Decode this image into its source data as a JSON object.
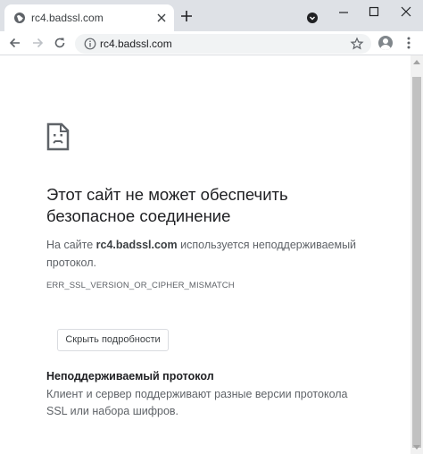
{
  "tab": {
    "title": "rc4.badssl.com"
  },
  "toolbar": {
    "url": "rc4.badssl.com"
  },
  "error": {
    "heading": "Этот сайт не может обеспечить безопасное соединение",
    "explain_prefix": "На сайте ",
    "explain_host": "rc4.badssl.com",
    "explain_suffix": " используется неподдерживаемый протокол.",
    "code": "ERR_SSL_VERSION_OR_CIPHER_MISMATCH",
    "details_button": "Скрыть подробности",
    "details_title": "Неподдерживаемый протокол",
    "details_text": "Клиент и сервер поддерживают разные версии протокола SSL или набора шифров."
  },
  "icons": {
    "favicon": "globe-icon",
    "new_tab": "plus-icon",
    "back": "arrow-left-icon",
    "forward": "arrow-right-icon",
    "reload": "reload-icon",
    "site_info": "info-icon",
    "bookmark": "star-icon",
    "profile": "profile-icon",
    "menu": "kebab-menu-icon",
    "error": "sad-document-icon"
  },
  "colors": {
    "titlebar": "#dee1e6",
    "omnibox": "#f1f3f4",
    "text_primary": "#202124",
    "text_secondary": "#5f6368"
  }
}
